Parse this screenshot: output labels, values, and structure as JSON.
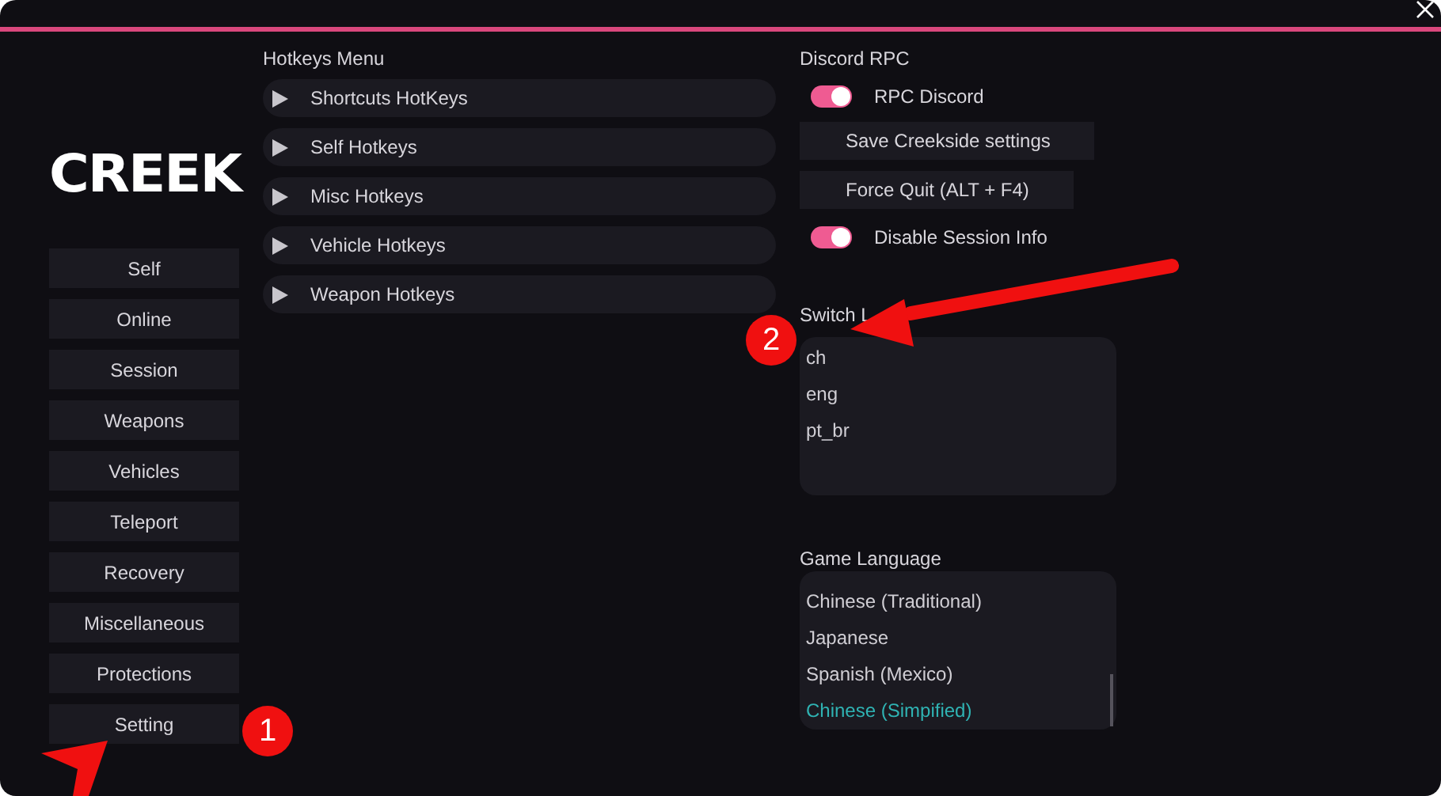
{
  "logo": "CREEK",
  "sidebar": {
    "items": [
      {
        "label": "Self"
      },
      {
        "label": "Online"
      },
      {
        "label": "Session"
      },
      {
        "label": "Weapons"
      },
      {
        "label": "Vehicles"
      },
      {
        "label": "Teleport"
      },
      {
        "label": "Recovery"
      },
      {
        "label": "Miscellaneous"
      },
      {
        "label": "Protections"
      },
      {
        "label": "Setting"
      }
    ]
  },
  "hotkeys": {
    "title": "Hotkeys Menu",
    "items": [
      {
        "label": "Shortcuts HotKeys",
        "expanded": false
      },
      {
        "label": "Self Hotkeys",
        "expanded": false
      },
      {
        "label": "Misc Hotkeys",
        "expanded": false
      },
      {
        "label": "Vehicle Hotkeys",
        "expanded": false
      },
      {
        "label": "Weapon Hotkeys",
        "expanded": false
      }
    ]
  },
  "discord": {
    "title": "Discord RPC",
    "controls": [
      {
        "kind": "toggle",
        "label": "RPC Discord",
        "on": true
      },
      {
        "kind": "button",
        "label": "Save Creekside settings"
      },
      {
        "kind": "button",
        "label": "Force Quit (ALT + F4)"
      },
      {
        "kind": "toggle",
        "label": "Disable Session Info",
        "on": true
      }
    ]
  },
  "switch_language": {
    "title": "Switch L",
    "items": [
      {
        "label": "ch",
        "selected": false
      },
      {
        "label": "eng",
        "selected": false
      },
      {
        "label": "pt_br",
        "selected": false
      }
    ]
  },
  "game_language": {
    "title": "Game Language",
    "items": [
      {
        "label": "Chinese (Traditional)",
        "selected": false
      },
      {
        "label": "Japanese",
        "selected": false
      },
      {
        "label": "Spanish (Mexico)",
        "selected": false
      },
      {
        "label": "Chinese (Simpified)",
        "selected": true
      }
    ]
  },
  "annotations": [
    {
      "number": "1"
    },
    {
      "number": "2"
    }
  ]
}
